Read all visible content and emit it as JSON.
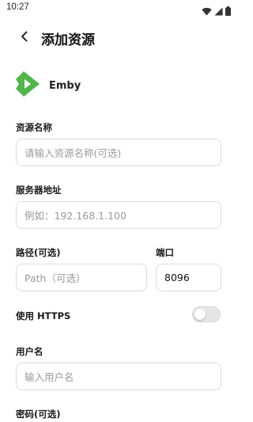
{
  "status_bar": {
    "time": "10:27",
    "icons": [
      "wifi-icon",
      "signal-icon",
      "battery-icon"
    ]
  },
  "header": {
    "title": "添加资源",
    "back_icon": "chevron-left-icon"
  },
  "server": {
    "name": "Emby",
    "logo_icon": "emby-logo-icon",
    "brand_color": "#52b54b"
  },
  "form": {
    "resource_name": {
      "label": "资源名称",
      "placeholder": "请输入资源名称(可选)",
      "value": ""
    },
    "server_address": {
      "label": "服务器地址",
      "placeholder": "例如：192.168.1.100",
      "value": ""
    },
    "path": {
      "label": "路径(可选)",
      "placeholder": "Path（可选）",
      "value": ""
    },
    "port": {
      "label": "端口",
      "value": "8096"
    },
    "https": {
      "label": "使用 HTTPS",
      "enabled": false
    },
    "username": {
      "label": "用户名",
      "placeholder": "输入用户名",
      "value": ""
    },
    "password": {
      "label": "密码(可选)"
    }
  }
}
